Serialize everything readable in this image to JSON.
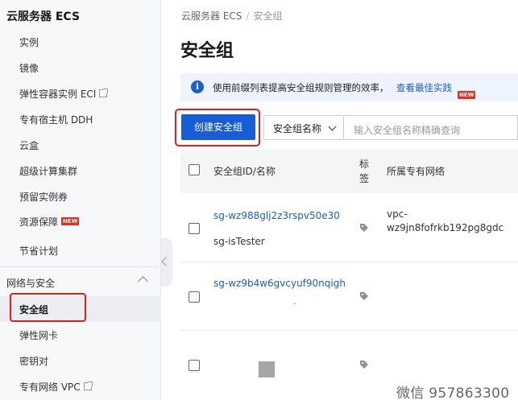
{
  "sidebar": {
    "title": "云服务器 ECS",
    "items": [
      {
        "label": "实例"
      },
      {
        "label": "镜像"
      },
      {
        "label": "弹性容器实例 ECI",
        "external": true
      },
      {
        "label": "专有宿主机 DDH"
      },
      {
        "label": "云盒"
      },
      {
        "label": "超级计算集群"
      },
      {
        "label": "预留实例券"
      },
      {
        "label": "资源保障",
        "badge": "NEW"
      },
      {
        "label": "节省计划"
      }
    ],
    "group": {
      "label": "网络与安全",
      "items": [
        {
          "label": "安全组",
          "active": true
        },
        {
          "label": "弹性网卡"
        },
        {
          "label": "密钥对"
        },
        {
          "label": "专有网络 VPC",
          "external": true
        }
      ]
    }
  },
  "breadcrumb": {
    "parent": "云服务器 ECS",
    "separator": "/",
    "current": "安全组"
  },
  "page_title": "安全组",
  "info_bar": {
    "text": "使用前缀列表提高安全组规则管理的效率，",
    "link": "查看最佳实践",
    "badge": "NEW"
  },
  "toolbar": {
    "create_label": "创建安全组",
    "select_value": "安全组名称",
    "search_placeholder": "输入安全组名称精确查询"
  },
  "table": {
    "columns": {
      "id_name": "安全组ID/名称",
      "tag_line1": "标",
      "tag_line2": "签",
      "vpc": "所属专有网络"
    },
    "rows": [
      {
        "id": "sg-wz988glj2z3rspv50e30",
        "name": "sg-isTester",
        "vpc_line1": "vpc-",
        "vpc_line2": "wz9jn8fofrkb192pg8gdc"
      },
      {
        "id": "sg-wz9b4w6gvcyuf90nqigh",
        "name": "",
        "vpc_line1": "",
        "vpc_line2": ""
      },
      {
        "id": "",
        "name": "",
        "vpc_line1": "",
        "vpc_line2": ""
      }
    ]
  },
  "watermark": "微信 957863300",
  "colors": {
    "accent": "#1a5cd6",
    "highlight": "#e0201c",
    "badge": "#e0301e"
  }
}
